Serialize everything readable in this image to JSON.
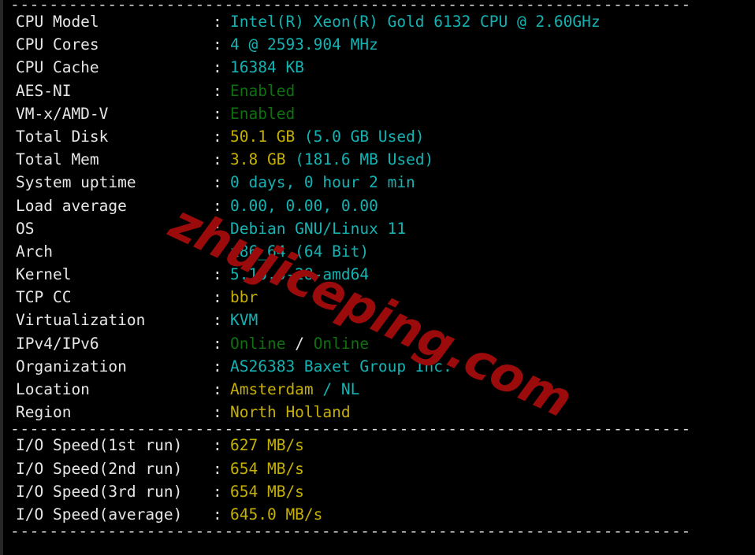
{
  "terminal": {
    "top_rule": "----------------------------------------------------------------------",
    "mid_rule": "----------------------------------------------------------------------",
    "bottom_rule": "----------------------------------------------------------------------",
    "separator": ":",
    "watermark": "zhujiceping.com",
    "colors": {
      "background": "#000000",
      "label": "#e6e6e6",
      "cyan": "#14b3b3",
      "green": "#0e700e",
      "yellow": "#c6b004",
      "watermark": "#9c0b0b",
      "border": "#272727"
    }
  },
  "system_info": [
    {
      "label": "CPU Model",
      "value": "Intel(R) Xeon(R) Gold 6132 CPU @ 2.60GHz",
      "color": "cyan"
    },
    {
      "label": "CPU Cores",
      "value": "4 @ 2593.904 MHz",
      "color": "cyan"
    },
    {
      "label": "CPU Cache",
      "value": "16384 KB",
      "color": "cyan"
    },
    {
      "label": "AES-NI",
      "value": "Enabled",
      "color": "green"
    },
    {
      "label": "VM-x/AMD-V",
      "value": "Enabled",
      "color": "green"
    },
    {
      "label": "Total Disk",
      "value": "50.1 GB",
      "color": "yellow",
      "value2": " (5.0 GB Used)",
      "color2": "cyan"
    },
    {
      "label": "Total Mem",
      "value": "3.8 GB",
      "color": "yellow",
      "value2": " (181.6 MB Used)",
      "color2": "cyan"
    },
    {
      "label": "System uptime",
      "value": "0 days, 0 hour 2 min",
      "color": "cyan"
    },
    {
      "label": "Load average",
      "value": "0.00, 0.00, 0.00",
      "color": "cyan"
    },
    {
      "label": "OS",
      "value": "Debian GNU/Linux 11",
      "color": "cyan"
    },
    {
      "label": "Arch",
      "value": "x86_64 (64 Bit)",
      "color": "cyan"
    },
    {
      "label": "Kernel",
      "value": "5.10.0-28-amd64",
      "color": "cyan"
    },
    {
      "label": "TCP CC",
      "value": "bbr",
      "color": "yellow"
    },
    {
      "label": "Virtualization",
      "value": "KVM",
      "color": "cyan"
    },
    {
      "label": "IPv4/IPv6",
      "value": "Online",
      "color": "green",
      "value2": " / ",
      "color2": "white",
      "value3": "Online",
      "color3": "green"
    },
    {
      "label": "Organization",
      "value": "AS26383 Baxet Group Inc.",
      "color": "cyan"
    },
    {
      "label": "Location",
      "value": "Amsterdam",
      "color": "yellow",
      "value2": " / NL",
      "color2": "cyan"
    },
    {
      "label": "Region",
      "value": "North Holland",
      "color": "yellow"
    }
  ],
  "io_speed": [
    {
      "label": "I/O Speed(1st run)",
      "value": "627 MB/s",
      "color": "yellow"
    },
    {
      "label": "I/O Speed(2nd run)",
      "value": "654 MB/s",
      "color": "yellow"
    },
    {
      "label": "I/O Speed(3rd run)",
      "value": "654 MB/s",
      "color": "yellow"
    },
    {
      "label": "I/O Speed(average)",
      "value": "645.0 MB/s",
      "color": "yellow"
    }
  ]
}
